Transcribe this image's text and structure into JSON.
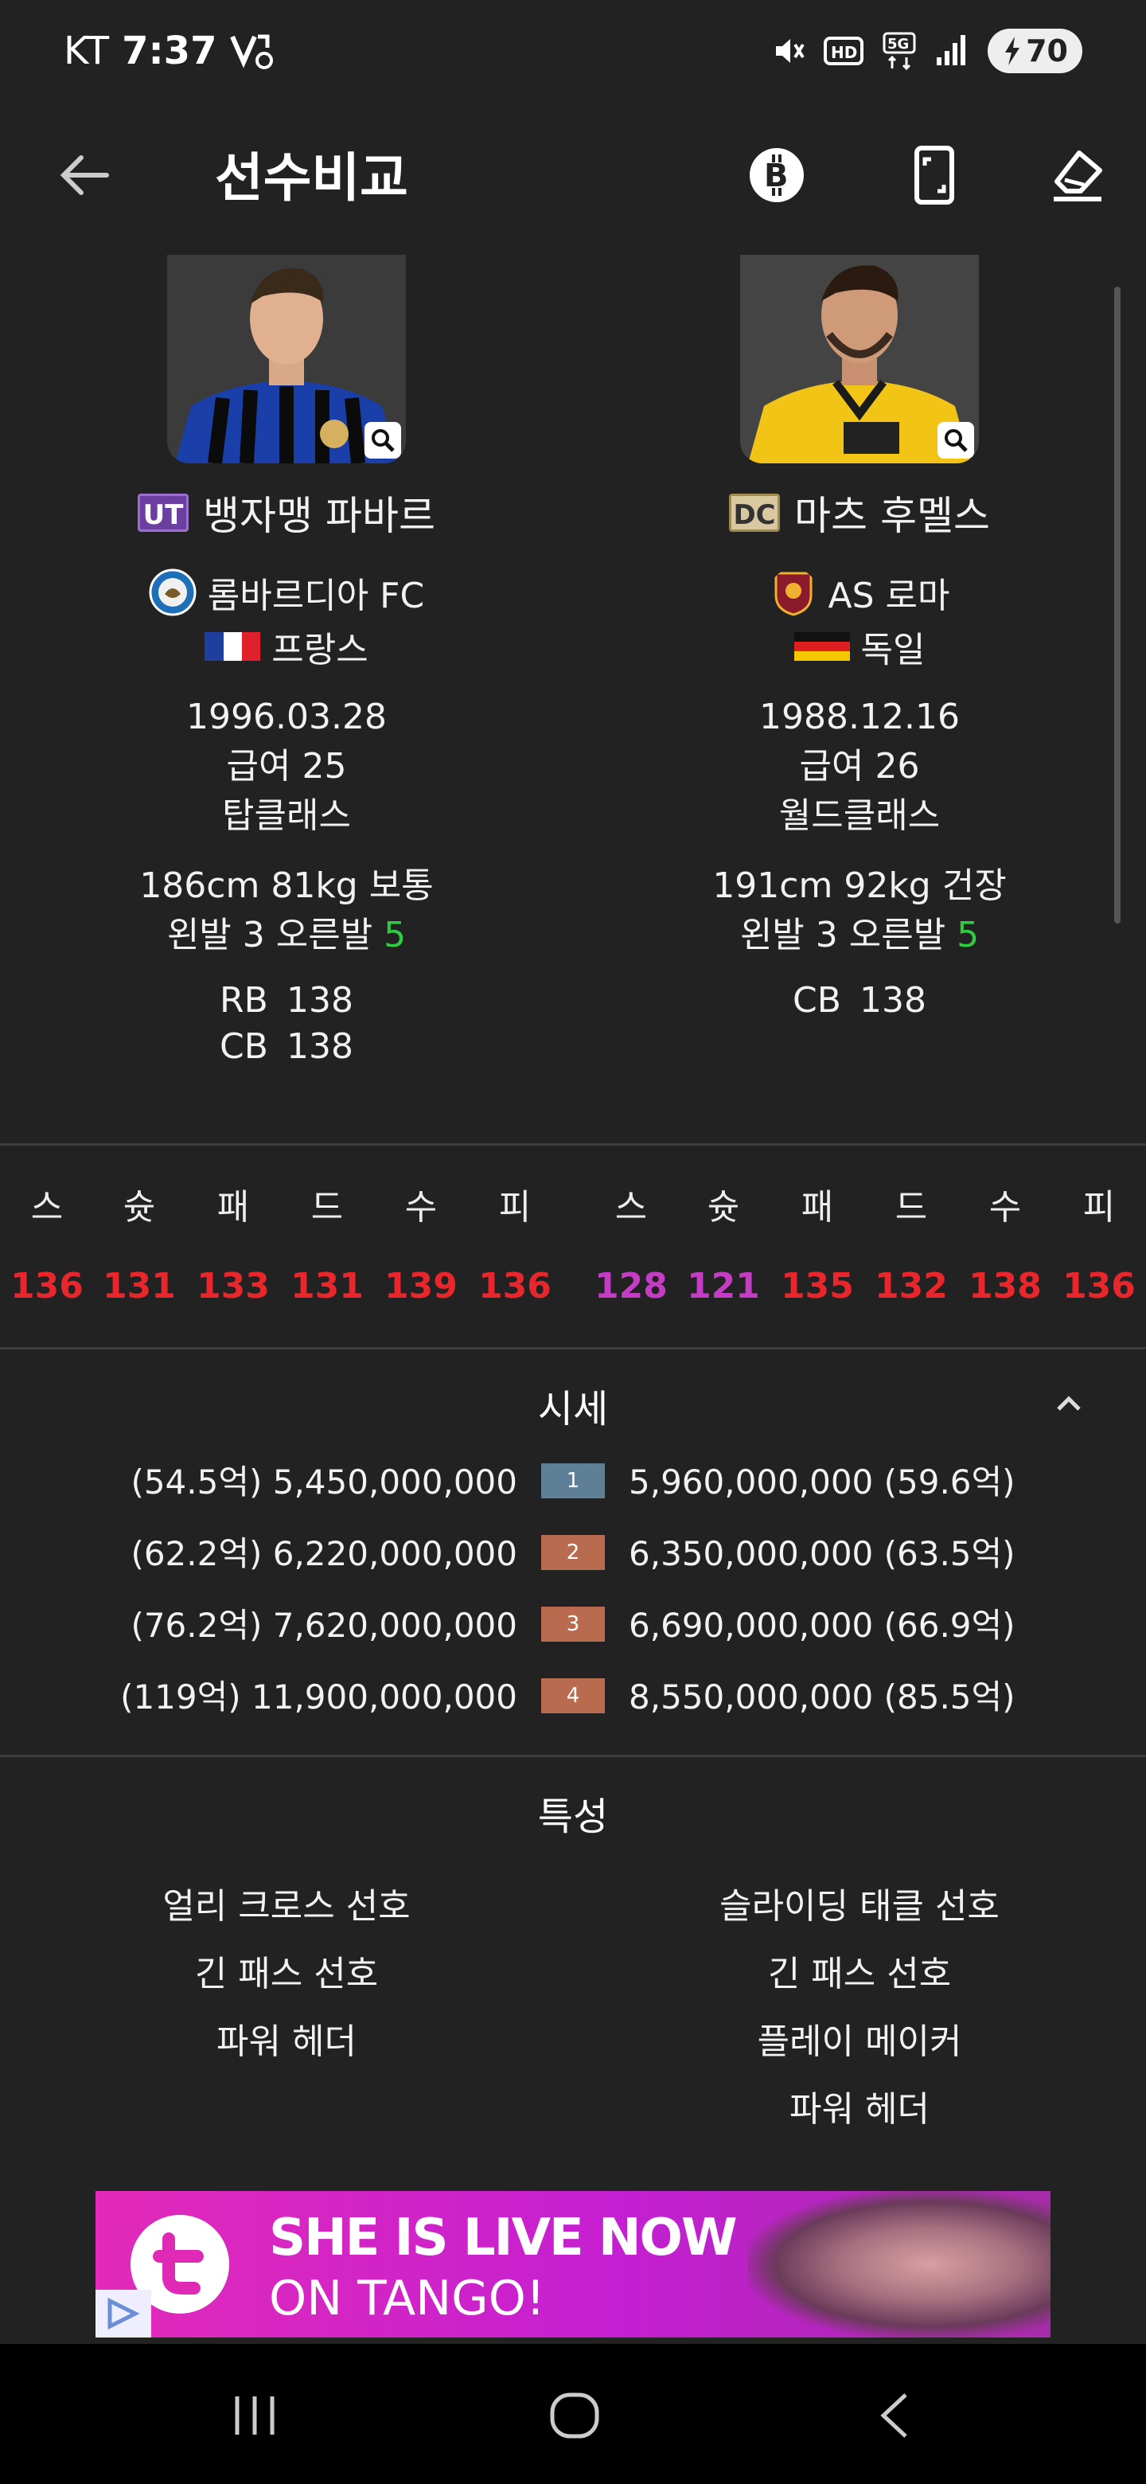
{
  "status_bar": {
    "carrier": "KT",
    "time": "7:37",
    "battery": "70"
  },
  "header": {
    "title": "선수비교"
  },
  "players": [
    {
      "season_badge": "UT",
      "name": "뱅자맹 파바르",
      "club": "롬바르디아 FC",
      "nation": "프랑스",
      "birth": "1996.03.28",
      "salary": "급여 25",
      "grade": "탑클래스",
      "body": "186cm 81kg 보통",
      "foot_prefix": "왼발 3 오른발 ",
      "foot_strong": "5",
      "positions": [
        {
          "pos": "RB",
          "ovr": "138"
        },
        {
          "pos": "CB",
          "ovr": "138"
        }
      ],
      "stats": [
        "136",
        "131",
        "133",
        "131",
        "139",
        "136"
      ]
    },
    {
      "season_badge": "DC",
      "name": "마츠 후멜스",
      "club": "AS 로마",
      "nation": "독일",
      "birth": "1988.12.16",
      "salary": "급여 26",
      "grade": "월드클래스",
      "body": "191cm 92kg 건장",
      "foot_prefix": "왼발 3 오른발 ",
      "foot_strong": "5",
      "positions": [
        {
          "pos": "CB",
          "ovr": "138"
        }
      ],
      "stats": [
        "128",
        "121",
        "135",
        "132",
        "138",
        "136"
      ]
    }
  ],
  "stat_labels": [
    "스",
    "슛",
    "패",
    "드",
    "수",
    "피"
  ],
  "colors": {
    "stat_red": "#e8262b",
    "stat_purple": "#c53cc5",
    "foot_green": "#2ecc40",
    "lvl1": "#5e7f95",
    "lvl2_4": "#b86b4e"
  },
  "price_section": {
    "title": "시세",
    "rows": [
      {
        "level": "1",
        "left": "(54.5억) 5,450,000,000",
        "right": "5,960,000,000 (59.6억)"
      },
      {
        "level": "2",
        "left": "(62.2억) 6,220,000,000",
        "right": "6,350,000,000 (63.5억)"
      },
      {
        "level": "3",
        "left": "(76.2억) 7,620,000,000",
        "right": "6,690,000,000 (66.9억)"
      },
      {
        "level": "4",
        "left": "(119억) 11,900,000,000",
        "right": "8,550,000,000 (85.5억)"
      }
    ]
  },
  "traits_section": {
    "title": "특성",
    "left": [
      "얼리 크로스 선호",
      "긴 패스 선호",
      "파워 헤더"
    ],
    "right": [
      "슬라이딩 태클 선호",
      "긴 패스 선호",
      "플레이 메이커",
      "파워 헤더"
    ]
  },
  "ad": {
    "line1": "SHE IS LIVE NOW",
    "line2": "ON TANGO!"
  }
}
